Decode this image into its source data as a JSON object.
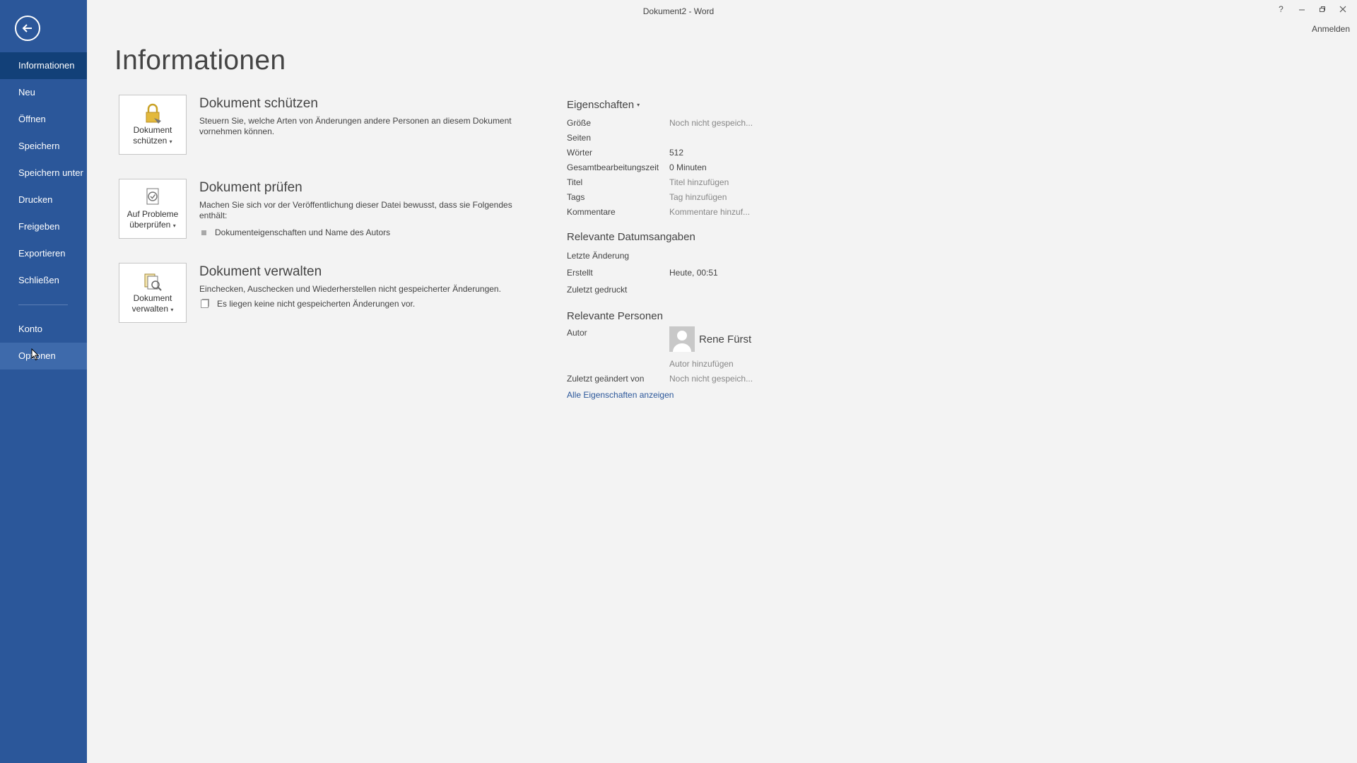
{
  "window": {
    "title": "Dokument2 - Word",
    "help_label": "?",
    "sign_in_label": "Anmelden"
  },
  "sidebar": {
    "back_icon": "arrow-left-circle-icon",
    "items": [
      {
        "label": "Informationen",
        "active": true
      },
      {
        "label": "Neu"
      },
      {
        "label": "Öffnen"
      },
      {
        "label": "Speichern"
      },
      {
        "label": "Speichern unter"
      },
      {
        "label": "Drucken"
      },
      {
        "label": "Freigeben"
      },
      {
        "label": "Exportieren"
      },
      {
        "label": "Schließen"
      }
    ],
    "bottom_items": [
      {
        "label": "Konto"
      },
      {
        "label": "Optionen",
        "hover": true
      }
    ],
    "colors": {
      "background": "#2b579a",
      "active": "#124078"
    }
  },
  "page": {
    "title": "Informationen"
  },
  "protect": {
    "button_line1": "Dokument",
    "button_line2": "schützen",
    "title": "Dokument schützen",
    "description": "Steuern Sie, welche Arten von Änderungen andere Personen an diesem Dokument vornehmen können."
  },
  "inspect": {
    "button_line1": "Auf Probleme",
    "button_line2": "überprüfen",
    "title": "Dokument prüfen",
    "description": "Machen Sie sich vor der Veröffentlichung dieser Datei bewusst, dass sie Folgendes enthält:",
    "bullet": "Dokumenteigenschaften und Name des Autors"
  },
  "manage": {
    "button_line1": "Dokument",
    "button_line2": "verwalten",
    "title": "Dokument verwalten",
    "description": "Einchecken, Auschecken und Wiederherstellen nicht gespeicherter Änderungen.",
    "note": "Es liegen keine nicht gespeicherten Änderungen vor."
  },
  "properties": {
    "title": "Eigenschaften",
    "rows": [
      {
        "key": "Größe",
        "value": "Noch nicht gespeich..."
      },
      {
        "key": "Seiten",
        "value": ""
      },
      {
        "key": "Wörter",
        "value": "512"
      },
      {
        "key": "Gesamtbearbeitungszeit",
        "value": "0 Minuten"
      },
      {
        "key": "Titel",
        "value": "Titel hinzufügen"
      },
      {
        "key": "Tags",
        "value": "Tag hinzufügen"
      },
      {
        "key": "Kommentare",
        "value": "Kommentare hinzuf..."
      }
    ]
  },
  "dates": {
    "title": "Relevante Datumsangaben",
    "rows": [
      {
        "key": "Letzte Änderung",
        "value": ""
      },
      {
        "key": "Erstellt",
        "value": "Heute, 00:51"
      },
      {
        "key": "Zuletzt gedruckt",
        "value": ""
      }
    ]
  },
  "people": {
    "title": "Relevante Personen",
    "author_label": "Autor",
    "author_name": "Rene Fürst",
    "add_author": "Autor hinzufügen",
    "last_modified_label": "Zuletzt geändert von",
    "last_modified_value": "Noch nicht gespeich..."
  },
  "show_all_label": "Alle Eigenschaften anzeigen"
}
